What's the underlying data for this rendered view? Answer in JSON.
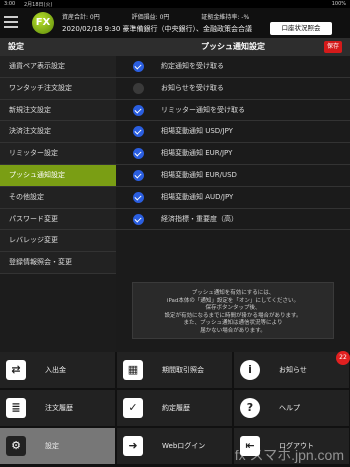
{
  "statusbar": {
    "time": "3:00",
    "date": "2月18日(火)",
    "battery": "100%"
  },
  "header": {
    "logo": "FX",
    "metrics": [
      "資産合計: 0円",
      "評価損益: 0円",
      "証拠金維持率: -%"
    ],
    "ticker": "2020/02/18 9:30 豪準備銀行（中央銀行）、金融政策会合議",
    "account_button": "口座状況照会"
  },
  "sidebar": {
    "title": "設定",
    "items": [
      {
        "label": "通貨ペア表示設定",
        "active": false
      },
      {
        "label": "ワンタッチ注文設定",
        "active": false
      },
      {
        "label": "新規注文設定",
        "active": false
      },
      {
        "label": "決済注文設定",
        "active": false
      },
      {
        "label": "リミッター設定",
        "active": false
      },
      {
        "label": "プッシュ通知設定",
        "active": true
      },
      {
        "label": "その他設定",
        "active": false
      },
      {
        "label": "パスワード変更",
        "active": false
      },
      {
        "label": "レバレッジ変更",
        "active": false
      },
      {
        "label": "登録情報照会・変更",
        "active": false
      }
    ]
  },
  "content": {
    "title": "プッシュ通知設定",
    "save_label": "保存",
    "options": [
      {
        "label": "約定通知を受け取る",
        "checked": true
      },
      {
        "label": "お知らせを受け取る",
        "checked": false
      },
      {
        "label": "リミッター通知を受け取る",
        "checked": true
      },
      {
        "label": "相場変動通知 USD/JPY",
        "checked": true
      },
      {
        "label": "相場変動通知 EUR/JPY",
        "checked": true
      },
      {
        "label": "相場変動通知 EUR/USD",
        "checked": true
      },
      {
        "label": "相場変動通知 AUD/JPY",
        "checked": true
      },
      {
        "label": "経済指標・重要度（高）",
        "checked": true
      }
    ],
    "note": [
      "プッシュ通知を有効にするには、",
      "iPad本体の「通知」設定を「オン」にしてください。",
      "保存ボタンタップ後、",
      "設定が有効になるまでに時間が掛かる場合があります。",
      "また、プッシュ通知は通信状況等により",
      "届かない場合があります。"
    ]
  },
  "bottom_nav": [
    {
      "label": "入出金",
      "icon": "deposit-withdraw-icon",
      "glyph": "⇄"
    },
    {
      "label": "期間取引照会",
      "icon": "calendar-icon",
      "glyph": "▦"
    },
    {
      "label": "お知らせ",
      "icon": "info-icon",
      "glyph": "i",
      "badge": "22"
    },
    {
      "label": "注文履歴",
      "icon": "order-history-icon",
      "glyph": "≣"
    },
    {
      "label": "約定履歴",
      "icon": "execution-history-icon",
      "glyph": "✓"
    },
    {
      "label": "ヘルプ",
      "icon": "help-icon",
      "glyph": "?"
    },
    {
      "label": "設定",
      "icon": "gear-icon",
      "glyph": "⚙",
      "active": true
    },
    {
      "label": "Webログイン",
      "icon": "web-login-icon",
      "glyph": "➜"
    },
    {
      "label": "ログアウト",
      "icon": "logout-icon",
      "glyph": "⇤"
    }
  ],
  "watermark": "fx スマホ.jpn.com"
}
